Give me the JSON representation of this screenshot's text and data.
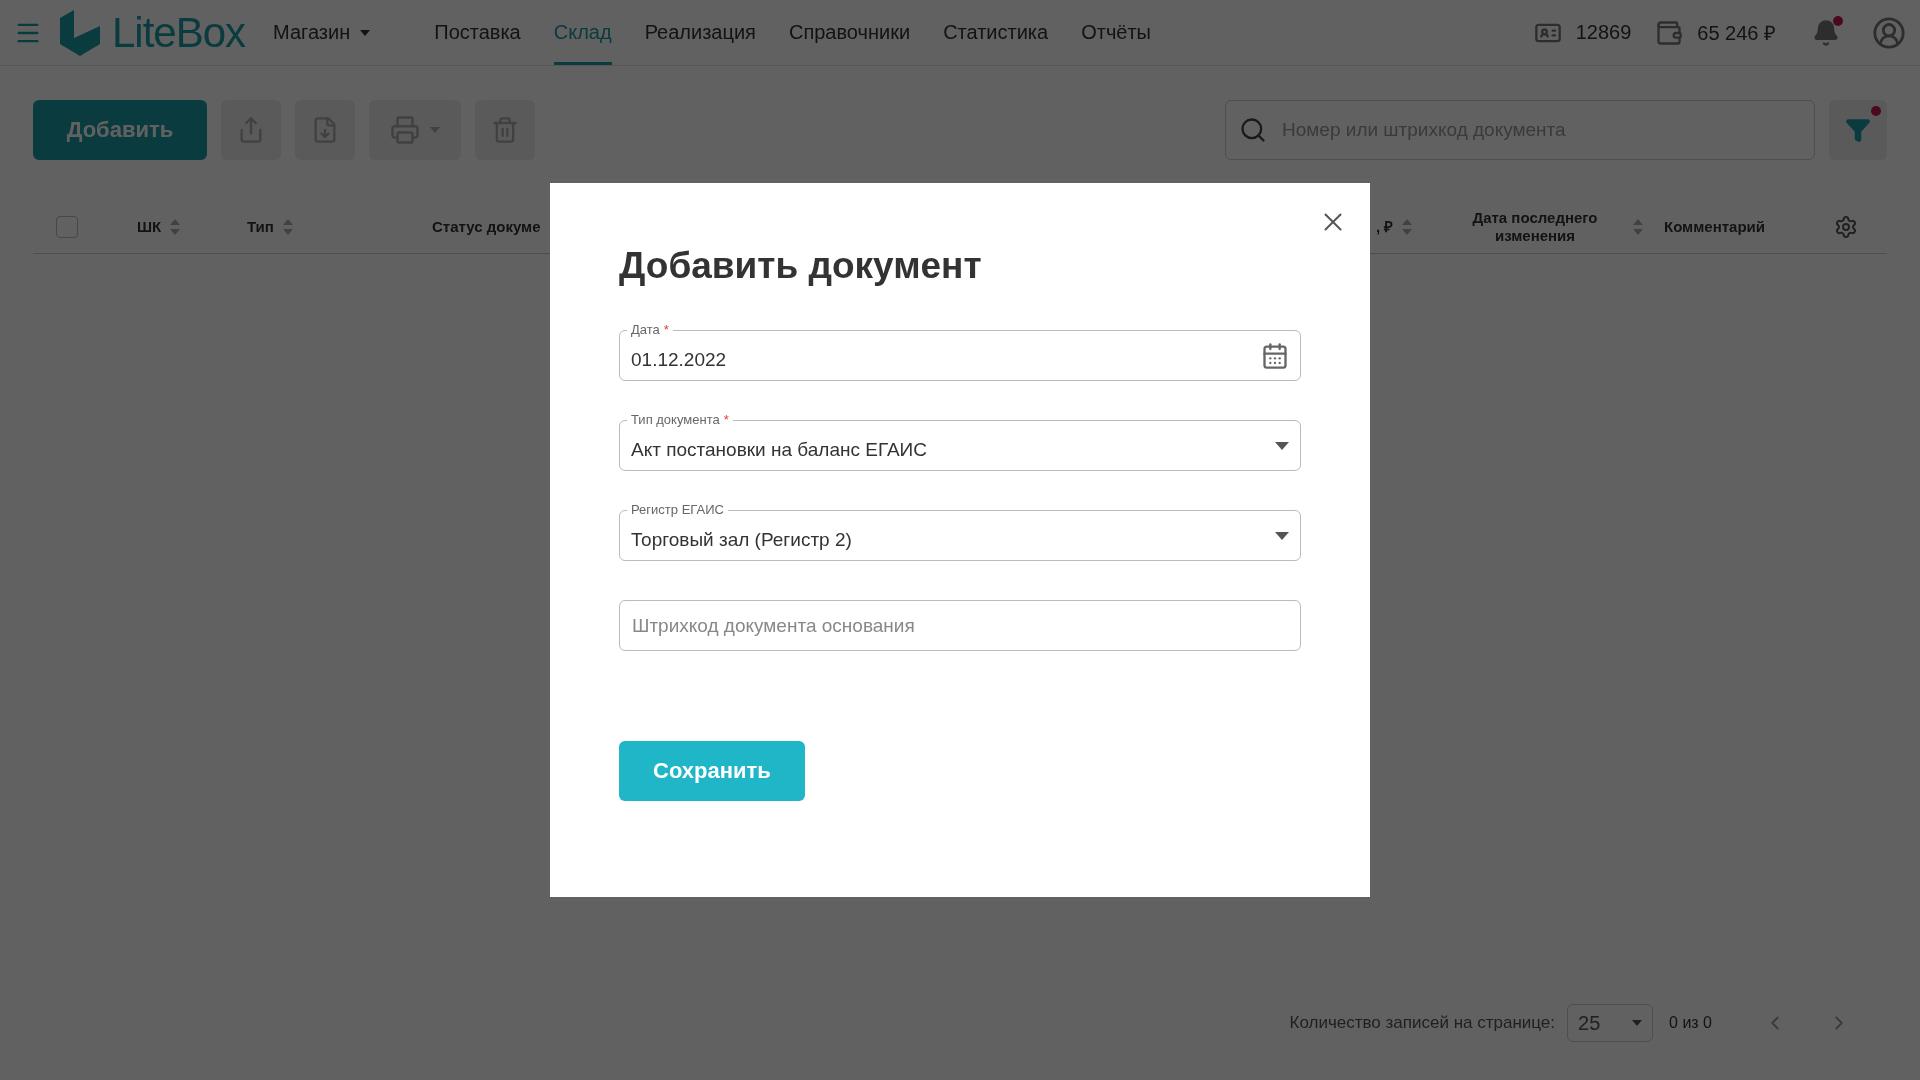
{
  "topbar": {
    "logo": "LiteBox",
    "store": "Магазин",
    "nav": [
      {
        "label": "Поставка",
        "selected": false
      },
      {
        "label": "Склад",
        "selected": true
      },
      {
        "label": "Реализация",
        "selected": false
      },
      {
        "label": "Справочники",
        "selected": false
      },
      {
        "label": "Статистика",
        "selected": false
      },
      {
        "label": "Отчёты",
        "selected": false
      }
    ],
    "account_id": "12869",
    "balance": "65 246 ₽",
    "notification": true
  },
  "toolbar": {
    "add_button": "Добавить",
    "search": {
      "placeholder": "Номер или штрихкод документа"
    },
    "filter_active": true
  },
  "table": {
    "select_all_checked": false,
    "columns": [
      {
        "label": "ШК",
        "sortable": true
      },
      {
        "label": "Тип",
        "sortable": true
      },
      {
        "label": "Статус докуме",
        "sortable": false
      },
      {
        "label": ", ₽",
        "sortable": true
      },
      {
        "label": "Дата последнего изменения",
        "sortable": true
      },
      {
        "label": "Комментарий",
        "sortable": false
      }
    ]
  },
  "pagination": {
    "label": "Количество записей на странице:",
    "page_size": "25",
    "range": "0 из 0"
  },
  "dialog": {
    "title": "Добавить документ",
    "fields": [
      {
        "kind": "date",
        "label": "Дата",
        "required_mark": "*",
        "value": "01.12.2022"
      },
      {
        "kind": "select",
        "label": "Тип документа",
        "required_mark": "*",
        "value": "Акт постановки на баланс ЕГАИС"
      },
      {
        "kind": "select",
        "label": "Регистр ЕГАИС",
        "value": "Торговый зал (Регистр 2)"
      },
      {
        "kind": "text",
        "placeholder": "Штрихкод документа основания"
      }
    ],
    "save_button": "Сохранить"
  }
}
